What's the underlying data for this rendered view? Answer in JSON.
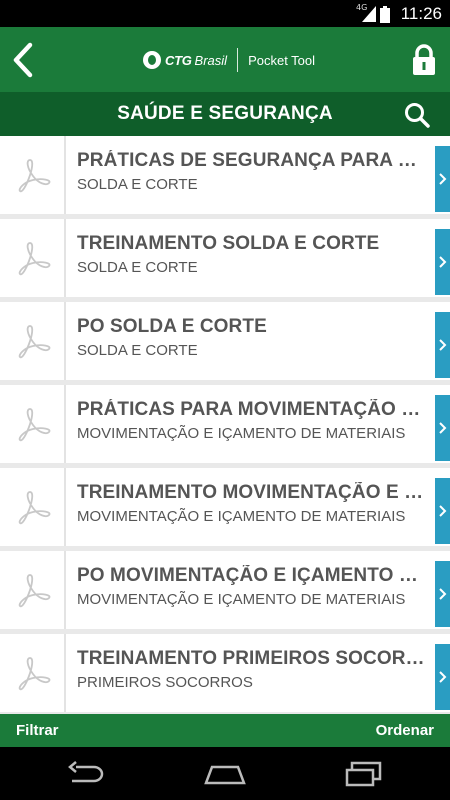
{
  "status_bar": {
    "time": "11:26",
    "network": "4G"
  },
  "app_bar": {
    "brand_bold": "CTG",
    "brand_light": "Brasil",
    "app_name": "Pocket Tool"
  },
  "section": {
    "title": "SAÚDE E SEGURANÇA"
  },
  "items": [
    {
      "title": "PRÁTICAS DE SEGURANÇA PARA SOLDA E CORTE",
      "subtitle": "SOLDA E CORTE"
    },
    {
      "title": "TREINAMENTO SOLDA E CORTE",
      "subtitle": "SOLDA E CORTE"
    },
    {
      "title": "PO SOLDA E CORTE",
      "subtitle": "SOLDA E CORTE"
    },
    {
      "title": "PRÁTICAS PARA MOVIMENTAÇÃO DE MATERIAIS",
      "subtitle": "MOVIMENTAÇÃO E IÇAMENTO DE MATERIAIS"
    },
    {
      "title": "TREINAMENTO MOVIMENTAÇÃO E IÇAMENTO",
      "subtitle": "MOVIMENTAÇÃO E IÇAMENTO DE MATERIAIS"
    },
    {
      "title": "PO MOVIMENTAÇÃO E IÇAMENTO DE MATERIAIS",
      "subtitle": "MOVIMENTAÇÃO E IÇAMENTO DE MATERIAIS"
    },
    {
      "title": "TREINAMENTO PRIMEIROS SOCORROS",
      "subtitle": "PRIMEIROS SOCORROS"
    }
  ],
  "bottom_bar": {
    "filter_label": "Filtrar",
    "order_label": "Ordenar"
  },
  "icons": {
    "back": "back-arrow-icon",
    "lock": "lock-icon",
    "search": "search-icon",
    "item_thumb": "pdf-icon",
    "item_arrow": "chevron-right-icon"
  },
  "colors": {
    "app_bar": "#1b7b3a",
    "sub_header": "#0f5e2a",
    "arrow_tab": "#2a9dc2"
  }
}
